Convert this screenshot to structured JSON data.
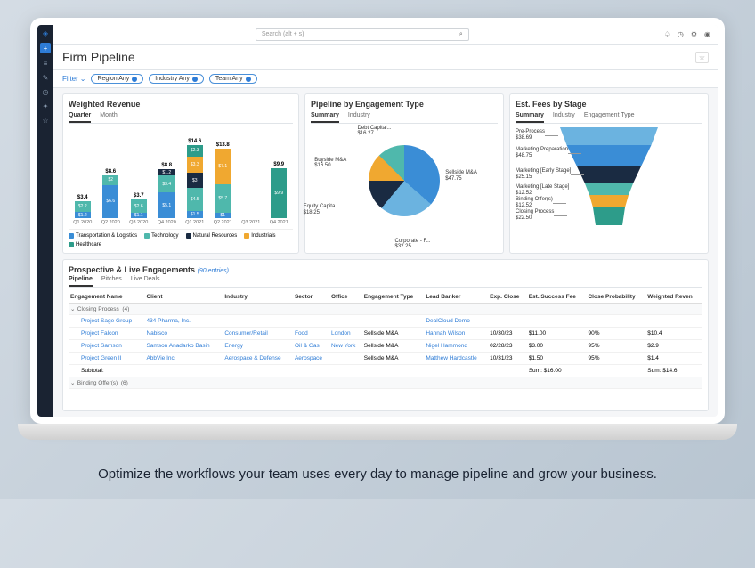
{
  "caption": "Optimize the workflows your team uses every day to manage pipeline and grow your business.",
  "search": {
    "placeholder": "Search (alt + s)"
  },
  "page": {
    "title": "Firm Pipeline"
  },
  "filters": {
    "label": "Filter",
    "pills": [
      "Region Any",
      "Industry Any",
      "Team Any"
    ]
  },
  "colors": {
    "transportation": "#3a8dd6",
    "technology": "#4fb8ac",
    "natural": "#1a2b42",
    "industrials": "#f0a830",
    "healthcare": "#2d9c8a"
  },
  "chart_data": [
    {
      "type": "bar",
      "title": "Weighted Revenue",
      "tabs": [
        "Quarter",
        "Month"
      ],
      "active_tab": "Quarter",
      "categories": [
        "Q1 2020",
        "Q2 2020",
        "Q3 2020",
        "Q4 2020",
        "Q1 2021",
        "Q2 2021",
        "Q3 2021",
        "Q4 2021"
      ],
      "totals": [
        3.4,
        8.6,
        3.7,
        8.8,
        14.6,
        13.8,
        null,
        9.9
      ],
      "series": [
        {
          "name": "Transportation & Logistics",
          "color": "#3a8dd6",
          "values": [
            1.2,
            6.6,
            1.1,
            5.1,
            1.5,
            1.0,
            null,
            0.0
          ]
        },
        {
          "name": "Technology",
          "color": "#4fb8ac",
          "values": [
            2.2,
            2.0,
            2.6,
            3.4,
            4.5,
            5.7,
            null,
            0.0
          ]
        },
        {
          "name": "Natural Resources",
          "color": "#1a2b42",
          "values": [
            0,
            0,
            0,
            1.2,
            3.0,
            0,
            null,
            0
          ]
        },
        {
          "name": "Industrials",
          "color": "#f0a830",
          "values": [
            0,
            0,
            0,
            0,
            3.3,
            7.1,
            null,
            0
          ]
        },
        {
          "name": "Healthcare",
          "color": "#2d9c8a",
          "values": [
            0,
            0,
            0,
            0,
            2.3,
            0,
            null,
            9.9
          ]
        }
      ],
      "ylim": [
        0,
        16
      ]
    },
    {
      "type": "pie",
      "title": "Pipeline by Engagement Type",
      "tabs": [
        "Summary",
        "Industry"
      ],
      "active_tab": "Summary",
      "slices": [
        {
          "name": "Sellside M&A",
          "value": 47.75,
          "color": "#3a8dd6"
        },
        {
          "name": "Corporate - F...",
          "value": 32.25,
          "color": "#6bb3e0"
        },
        {
          "name": "Equity Capita...",
          "value": 18.25,
          "color": "#1a2b42"
        },
        {
          "name": "Buyside M&A",
          "value": 16.5,
          "color": "#f0a830"
        },
        {
          "name": "Debt Capital...",
          "value": 16.27,
          "color": "#4fb8ac"
        }
      ]
    },
    {
      "type": "funnel",
      "title": "Est. Fees by Stage",
      "tabs": [
        "Summary",
        "Industry",
        "Engagement Type"
      ],
      "active_tab": "Summary",
      "stages": [
        {
          "name": "Pre-Process",
          "value": 38.69,
          "color": "#6bb3e0"
        },
        {
          "name": "Marketing Preparation",
          "value": 48.75,
          "color": "#3a8dd6"
        },
        {
          "name": "Marketing [Early Stage]",
          "value": 25.15,
          "color": "#1a2b42"
        },
        {
          "name": "Marketing [Late Stage]",
          "value": 12.52,
          "color": "#4fb8ac"
        },
        {
          "name": "Binding Offer(s)",
          "value": 12.52,
          "color": "#f0a830"
        },
        {
          "name": "Closing Process",
          "value": 22.5,
          "color": "#2d9c8a"
        }
      ]
    }
  ],
  "table": {
    "title": "Prospective & Live Engagements",
    "entries_text": "(90 entries)",
    "tabs": [
      "Pipeline",
      "Pitches",
      "Live Deals"
    ],
    "active_tab": "Pipeline",
    "columns": [
      "Engagement Name",
      "Client",
      "Industry",
      "Sector",
      "Office",
      "Engagement Type",
      "Lead Banker",
      "Exp. Close",
      "Est. Success Fee",
      "Close Probability",
      "Weighted Reven"
    ],
    "groups": [
      {
        "name": "Closing Process",
        "count": 4
      },
      {
        "name": "Binding Offer(s)",
        "count": 6
      }
    ],
    "rows": [
      {
        "name": "Project Sage Group",
        "client": "434 Pharma, Inc.",
        "industry": "",
        "sector": "",
        "office": "",
        "type": "",
        "banker": "DealCloud Demo",
        "close": "",
        "fee": "",
        "prob": "",
        "rev": ""
      },
      {
        "name": "Project Falcon",
        "client": "Nabisco",
        "industry": "Consumer/Retail",
        "sector": "Food",
        "office": "London",
        "type": "Sellside M&A",
        "banker": "Hannah Wilson",
        "close": "10/30/23",
        "fee": "$11.00",
        "prob": "90%",
        "rev": "$10.4"
      },
      {
        "name": "Project Samson",
        "client": "Samson Anadarko Basin",
        "industry": "Energy",
        "sector": "Oil & Gas",
        "office": "New York",
        "type": "Sellside M&A",
        "banker": "Nigel Hammond",
        "close": "02/28/23",
        "fee": "$3.00",
        "prob": "95%",
        "rev": "$2.9"
      },
      {
        "name": "Project Green II",
        "client": "AbbVie Inc.",
        "industry": "Aerospace & Defense",
        "sector": "Aerospace",
        "office": "",
        "type": "Sellside M&A",
        "banker": "Matthew Hardcastle",
        "close": "10/31/23",
        "fee": "$1.50",
        "prob": "95%",
        "rev": "$1.4"
      }
    ],
    "subtotal": {
      "label": "Subtotal:",
      "fee": "Sum: $16.00",
      "rev": "Sum: $14.6"
    }
  }
}
